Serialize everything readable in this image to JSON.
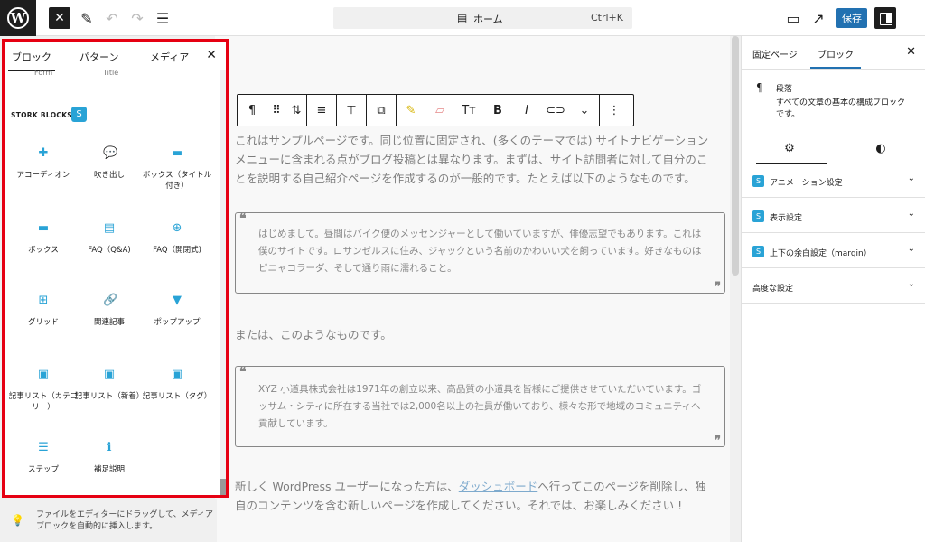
{
  "topbar": {
    "logo_glyph": "W",
    "close_glyph": "✕",
    "pencil_glyph": "✎",
    "undo_glyph": "↶",
    "redo_glyph": "↷",
    "list_view_glyph": "☰",
    "command": {
      "doc_glyph": "▤",
      "title": "ホーム",
      "shortcut": "Ctrl+K"
    },
    "view_glyph": "▭",
    "external_glyph": "↗",
    "save_label": "保存"
  },
  "inserter": {
    "tabs": [
      "ブロック",
      "パターン",
      "メディア"
    ],
    "active_tab": "ブロック",
    "close_glyph": "✕",
    "cutoff_labels": [
      "Form",
      "Title"
    ],
    "category": {
      "title": "STORK BLOCKS",
      "badge": "S",
      "accent": "#29a3d6"
    },
    "blocks": [
      {
        "label": "アコーディオン",
        "icon": "plus-circle-icon",
        "glyph": "✚"
      },
      {
        "label": "吹き出し",
        "icon": "speech-bubble-icon",
        "glyph": "💬"
      },
      {
        "label": "ボックス（タイトル付き）",
        "icon": "box-title-icon",
        "glyph": "▬"
      },
      {
        "label": "ボックス",
        "icon": "box-icon",
        "glyph": "▬"
      },
      {
        "label": "FAQ（Q&A)",
        "icon": "faq-icon",
        "glyph": "▤"
      },
      {
        "label": "FAQ（開閉式)",
        "icon": "faq-toggle-icon",
        "glyph": "⊕"
      },
      {
        "label": "グリッド",
        "icon": "grid-icon",
        "glyph": "⊞"
      },
      {
        "label": "関連記事",
        "icon": "link-icon",
        "glyph": "🔗"
      },
      {
        "label": "ポップアップ",
        "icon": "popup-icon",
        "glyph": "▼"
      },
      {
        "label": "記事リスト（カテゴリー）",
        "icon": "post-list-category-icon",
        "glyph": "▣"
      },
      {
        "label": "記事リスト（新着）",
        "icon": "post-list-new-icon",
        "glyph": "▣"
      },
      {
        "label": "記事リスト（タグ）",
        "icon": "post-list-tag-icon",
        "glyph": "▣"
      },
      {
        "label": "ステップ",
        "icon": "steps-icon",
        "glyph": "☰"
      },
      {
        "label": "補足説明",
        "icon": "info-icon",
        "glyph": "ℹ"
      }
    ],
    "hint": {
      "glyph": "💡",
      "text": "ファイルをエディターにドラッグして、メディアブロックを自動的に挿入します。"
    }
  },
  "editor": {
    "toolbar": [
      "¶",
      "⠿",
      "⇅",
      "≡",
      "⊤",
      "⧉",
      "✎",
      "▱",
      "Tт",
      "B",
      "I",
      "⊂⊃",
      "⌄",
      "⋮"
    ],
    "paragraphs": [
      "これはサンプルページです。同じ位置に固定され、(多くのテーマでは) サイトナビゲーションメニューに含まれる点がブログ投稿とは異なります。まずは、サイト訪問者に対して自分のことを説明する自己紹介ページを作成するのが一般的です。たとえば以下のようなものです。",
      "または、このようなものです。"
    ],
    "quote_open": "❝",
    "quote_close": "❞",
    "quotes": [
      "はじめまして。昼間はバイク便のメッセンジャーとして働いていますが、俳優志望でもあります。これは僕のサイトです。ロサンゼルスに住み、ジャックという名前のかわいい犬を飼っています。好きなものはピニャコラーダ、そして通り雨に濡れること。",
      "XYZ 小道具株式会社は1971年の創立以来、高品質の小道具を皆様にご提供させていただいています。ゴッサム・シティに所在する当社では2,000名以上の社員が働いており、様々な形で地域のコミュニティへ貢献しています。"
    ],
    "final_before": "新しく WordPress ユーザーになった方は、",
    "final_link": "ダッシュボード",
    "final_after": "へ行ってこのページを削除し、独自のコンテンツを含む新しいページを作成してください。それでは、お楽しみください !"
  },
  "sidebar": {
    "tabs": [
      "固定ページ",
      "ブロック"
    ],
    "active_tab": "ブロック",
    "close_glyph": "✕",
    "block_card": {
      "glyph": "¶",
      "title": "段落",
      "description": "すべての文章の基本の構成ブロックです。"
    },
    "subtabs": [
      {
        "name": "settings",
        "glyph": "⚙"
      },
      {
        "name": "styles",
        "glyph": "◐"
      }
    ],
    "panels": [
      {
        "label": "アニメーション設定",
        "badge": "S"
      },
      {
        "label": "表示設定",
        "badge": "S"
      },
      {
        "label": "上下の余白設定（margin）",
        "badge": "S"
      },
      {
        "label": "高度な設定",
        "badge": ""
      }
    ],
    "chevron": "⌄"
  }
}
